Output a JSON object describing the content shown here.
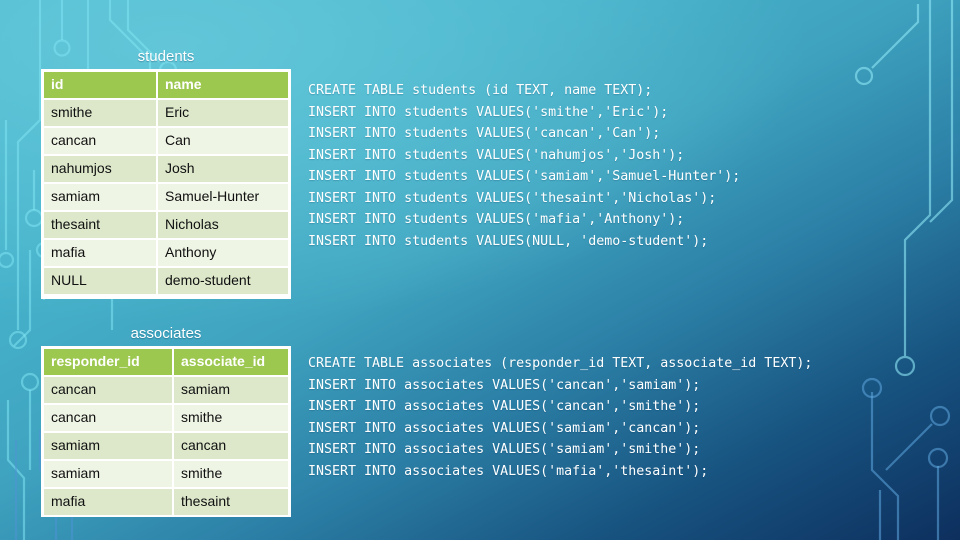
{
  "slide": {
    "background_top_color": "#4fbcd3",
    "background_bottom_color": "#0d2f5e",
    "accent_header_color": "#9dc84f",
    "row_color_odd": "#dde8cb",
    "row_color_even": "#eff5e5"
  },
  "tables": [
    {
      "caption": "students",
      "columns": [
        "id",
        "name"
      ],
      "rows": [
        [
          "smithe",
          "Eric"
        ],
        [
          "cancan",
          "Can"
        ],
        [
          "nahumjos",
          "Josh"
        ],
        [
          "samiam",
          "Samuel-Hunter"
        ],
        [
          "thesaint",
          "Nicholas"
        ],
        [
          "mafia",
          "Anthony"
        ],
        [
          "NULL",
          "demo-student"
        ]
      ]
    },
    {
      "caption": "associates",
      "columns": [
        "responder_id",
        "associate_id"
      ],
      "rows": [
        [
          "cancan",
          "samiam"
        ],
        [
          "cancan",
          "smithe"
        ],
        [
          "samiam",
          "cancan"
        ],
        [
          "samiam",
          "smithe"
        ],
        [
          "mafia",
          "thesaint"
        ]
      ]
    }
  ],
  "sql": {
    "students": "CREATE TABLE students (id TEXT, name TEXT);\nINSERT INTO students VALUES('smithe','Eric');\nINSERT INTO students VALUES('cancan','Can');\nINSERT INTO students VALUES('nahumjos','Josh');\nINSERT INTO students VALUES('samiam','Samuel-Hunter');\nINSERT INTO students VALUES('thesaint','Nicholas');\nINSERT INTO students VALUES('mafia','Anthony');\nINSERT INTO students VALUES(NULL, 'demo-student');",
    "associates": "CREATE TABLE associates (responder_id TEXT, associate_id TEXT);\nINSERT INTO associates VALUES('cancan','samiam');\nINSERT INTO associates VALUES('cancan','smithe');\nINSERT INTO associates VALUES('samiam','cancan');\nINSERT INTO associates VALUES('samiam','smithe');\nINSERT INTO associates VALUES('mafia','thesaint');"
  }
}
